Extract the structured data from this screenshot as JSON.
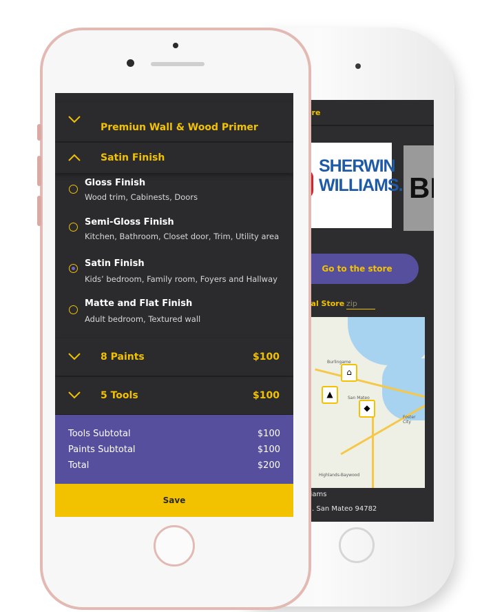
{
  "back_screen": {
    "header_fragment": "ore",
    "brand1_name": "SHERWIN WILLIAMS.",
    "brand2_fragment": "BE",
    "store_button": "Go to the store",
    "local_store_label": "cal Store",
    "zip_placeholder": "zip",
    "map_labels": {
      "burlingame": "Burlingame",
      "san_mateo": "San Mateo",
      "foster_city": "Foster City",
      "highlands": "Highlands-Baywood"
    },
    "footer_line1": "lliams",
    "footer_line2": ". San Mateo  94782"
  },
  "accordion": {
    "primer": {
      "label": "Premiun Wall & Wood Primer",
      "icon": "chevron-down-icon"
    },
    "finish": {
      "label": "Satin Finish",
      "icon": "chevron-up-icon"
    },
    "options": [
      {
        "title": "Gloss Finish",
        "desc": "Wood trim, Cabinests, Doors",
        "selected": false
      },
      {
        "title": "Semi-Gloss Finish",
        "desc": "Kitchen, Bathroom, Closet door, Trim, Utility area",
        "selected": false
      },
      {
        "title": "Satin Finish",
        "desc": "Kids’  bedroom, Family room, Foyers and Hallway",
        "selected": true
      },
      {
        "title": "Matte and Flat Finish",
        "desc": "Adult bedroom, Textured wall",
        "selected": false
      }
    ],
    "paints": {
      "label": "8 Paints",
      "price": "$100",
      "icon": "chevron-down-icon"
    },
    "tools": {
      "label": "5 Tools",
      "price": "$100",
      "icon": "chevron-down-icon"
    }
  },
  "summary": {
    "tools_label": "Tools Subtotal",
    "tools_value": "$100",
    "paints_label": "Paints Subtotal",
    "paints_value": "$100",
    "total_label": "Total",
    "total_value": "$200"
  },
  "save_label": "Save",
  "colors": {
    "accent_yellow": "#f2c200",
    "purple": "#554f9e",
    "screen_dark": "#2b2b2d",
    "phone_rose": "#e2b9b3"
  }
}
